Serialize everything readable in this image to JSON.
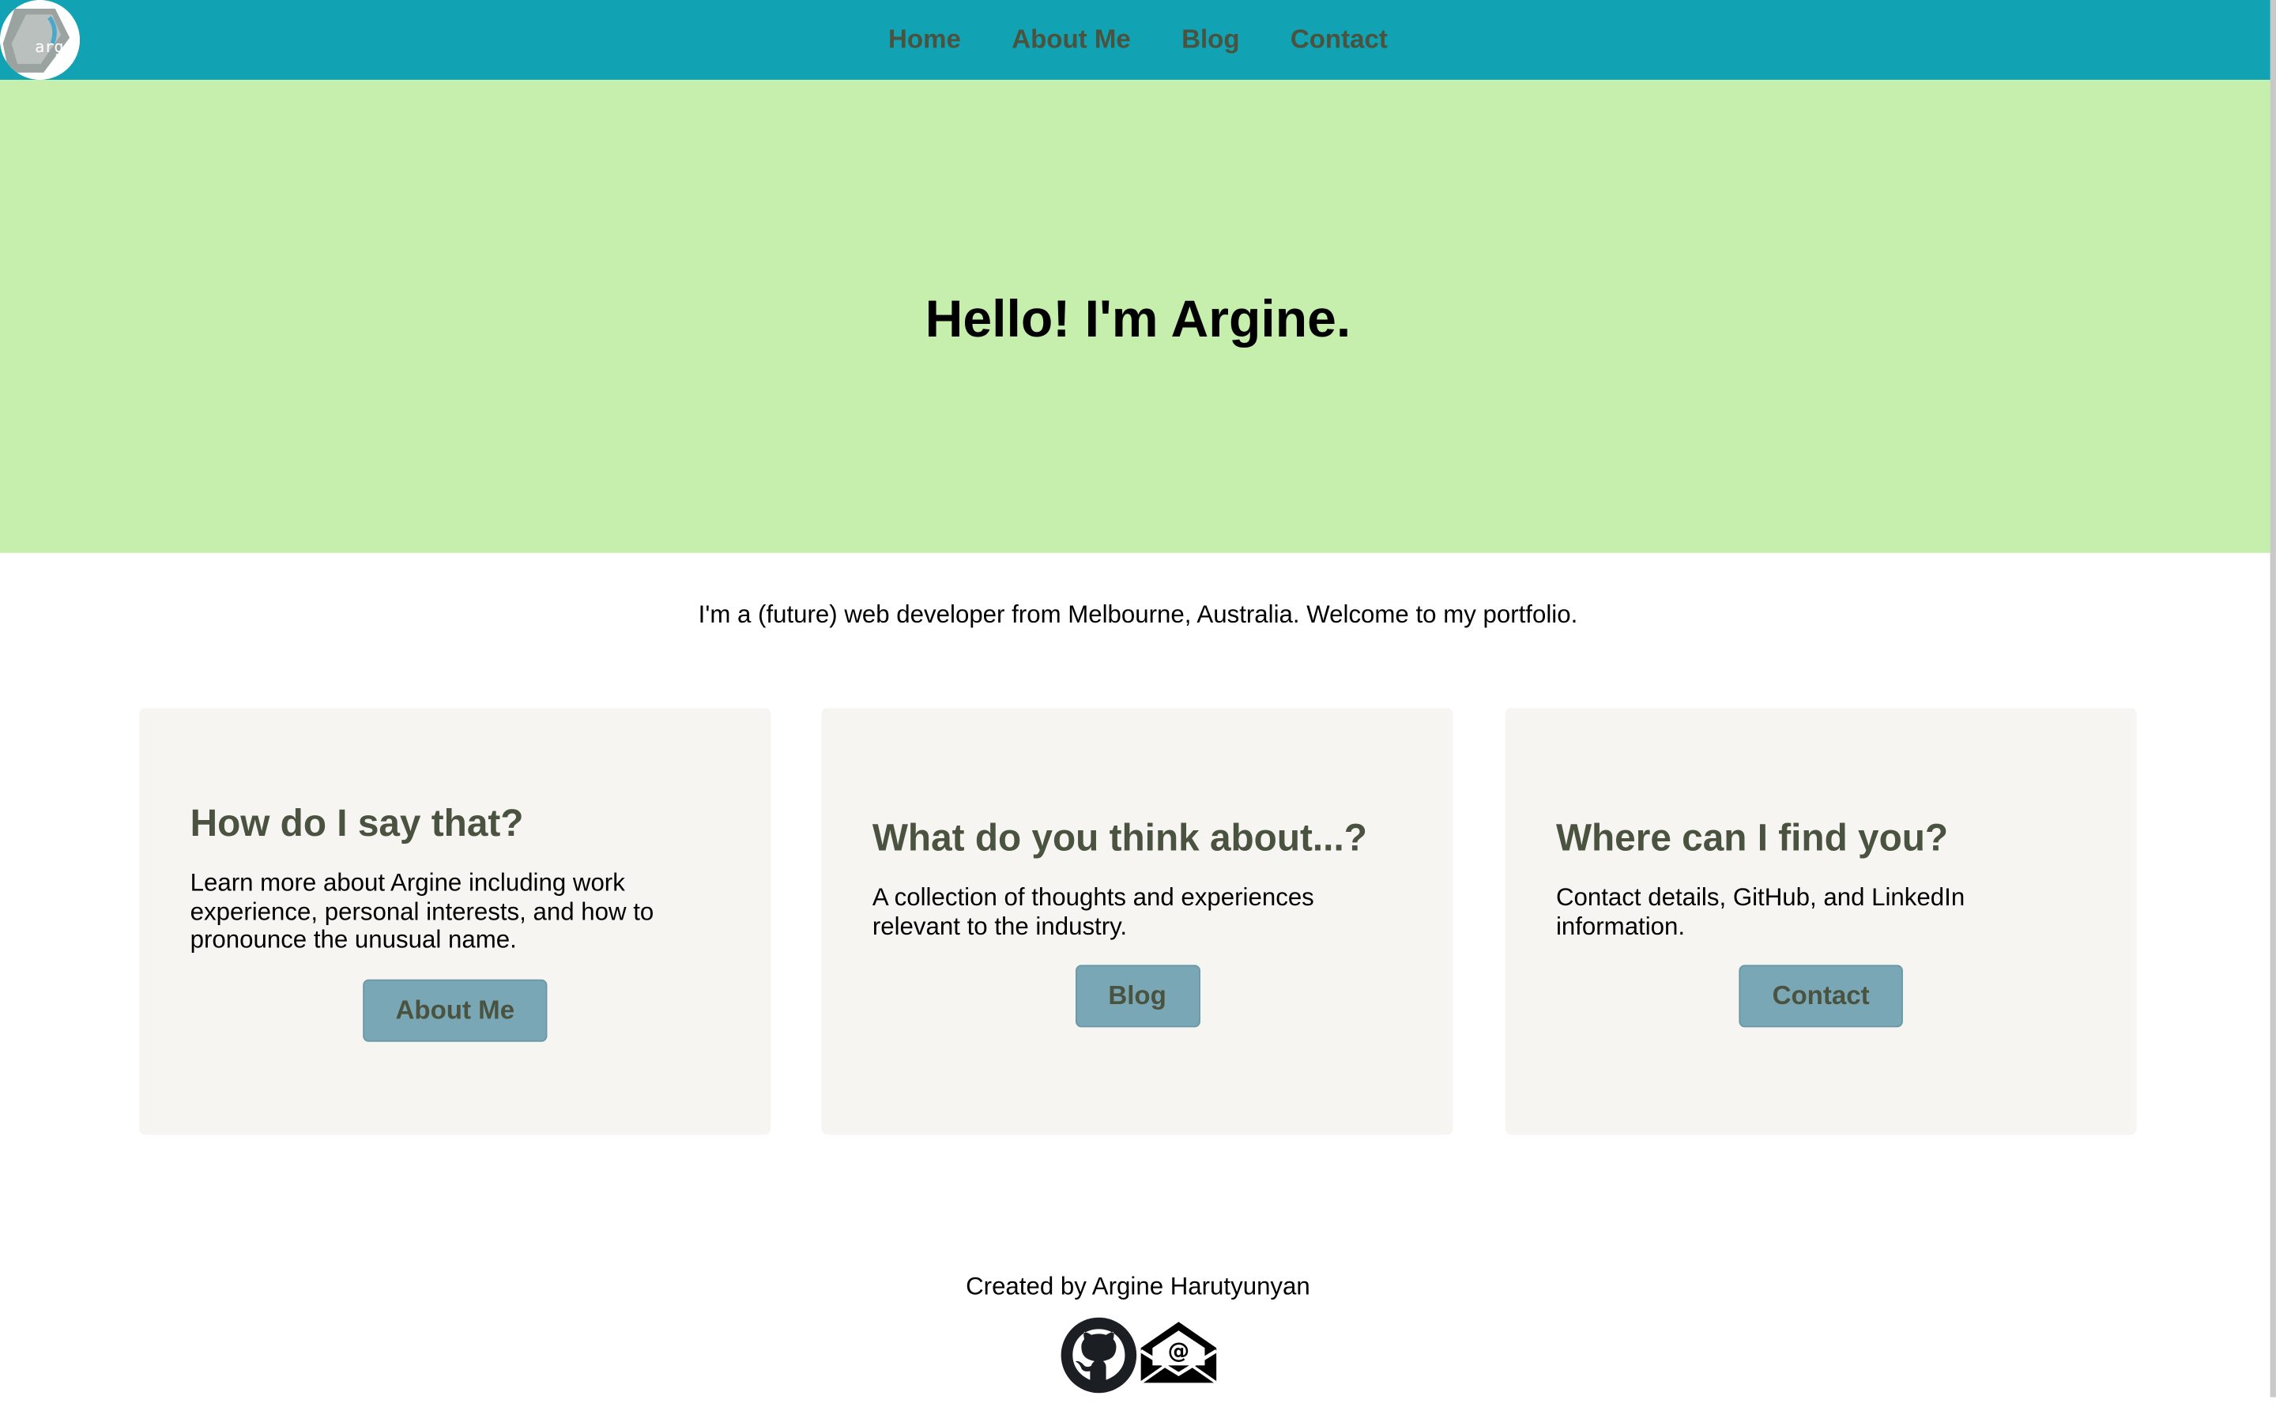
{
  "nav": {
    "logo_text": "arg",
    "links": [
      {
        "label": "Home"
      },
      {
        "label": "About Me"
      },
      {
        "label": "Blog"
      },
      {
        "label": "Contact"
      }
    ]
  },
  "hero": {
    "title": "Hello! I'm Argine."
  },
  "intro": "I'm a (future) web developer from Melbourne, Australia. Welcome to my portfolio.",
  "cards": [
    {
      "title": "How do I say that?",
      "text": "Learn more about Argine including work experience, personal interests, and how to pronounce the unusual name.",
      "button": "About Me"
    },
    {
      "title": "What do you think about...?",
      "text": "A collection of thoughts and experiences relevant to the industry.",
      "button": "Blog"
    },
    {
      "title": "Where can I find you?",
      "text": "Contact details, GitHub, and LinkedIn information.",
      "button": "Contact"
    }
  ],
  "footer": {
    "credit": "Created by Argine Harutyunyan",
    "icons": [
      "github-icon",
      "email-icon"
    ]
  },
  "colors": {
    "navbar": "#11a3b3",
    "hero": "#c6eeac",
    "card": "#f6f5f2",
    "button": "#7aa7b5",
    "heading": "#4a5240"
  }
}
